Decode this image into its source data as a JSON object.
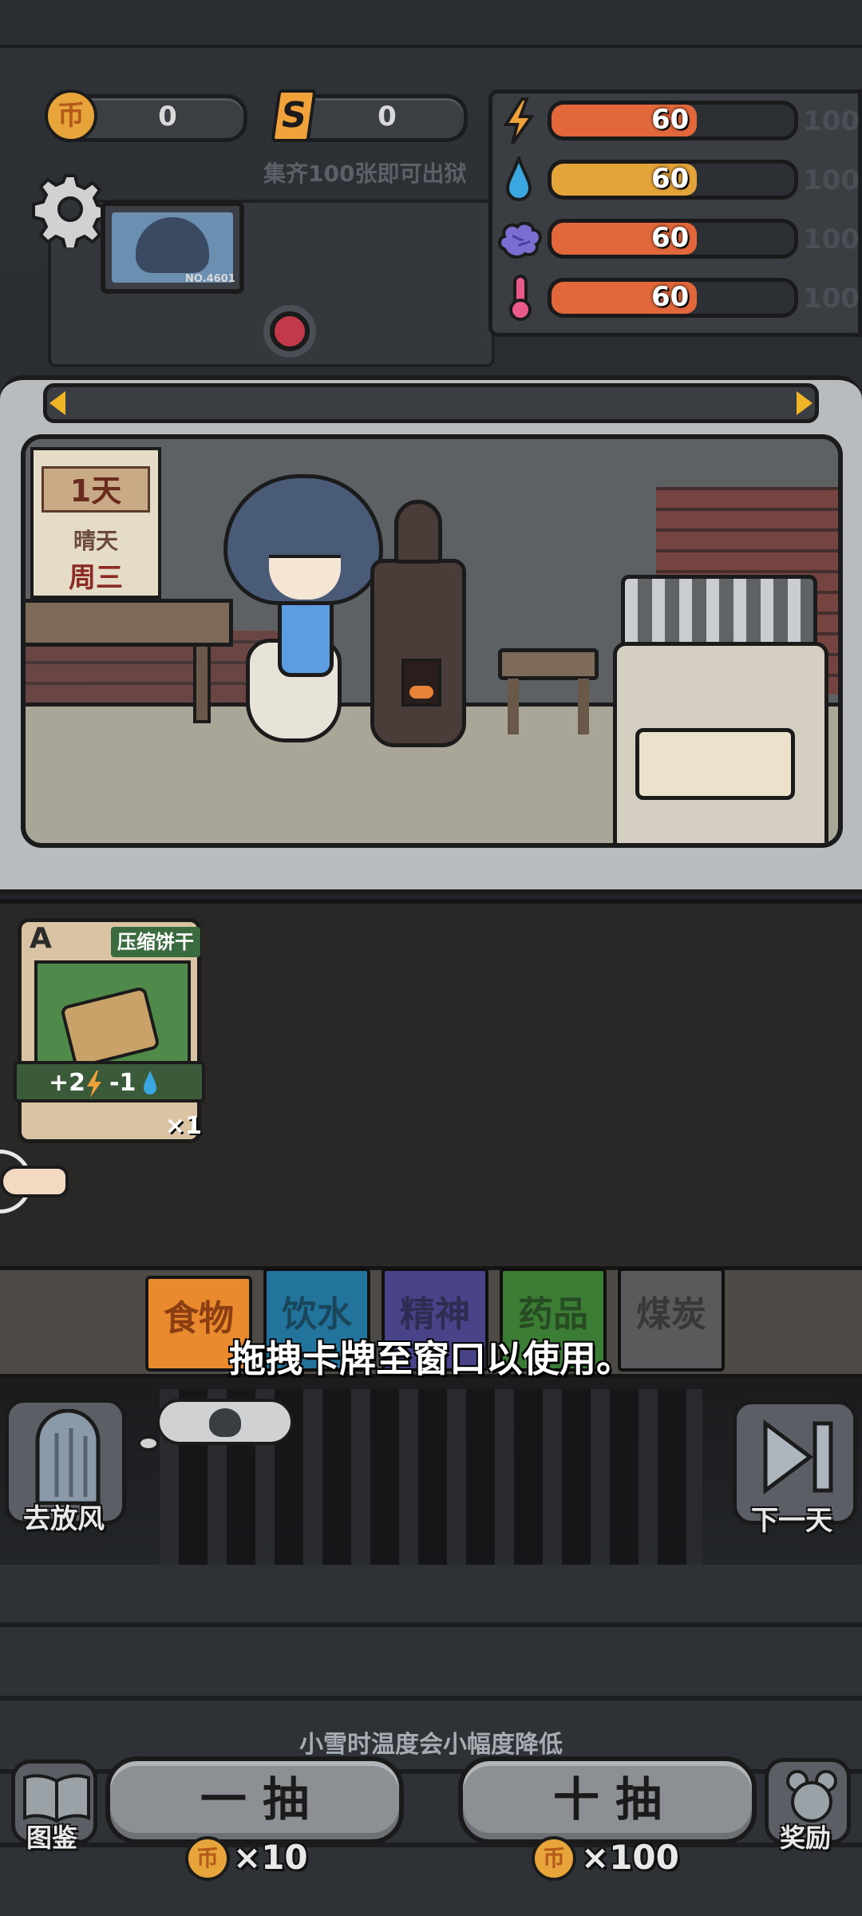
{
  "currency": {
    "coins": "0",
    "tickets": "0",
    "coin_glyph": "币",
    "ticket_glyph": "S"
  },
  "collect_hint": "集齐100张即可出狱",
  "portrait_id": "NO.4601",
  "stats": [
    {
      "name": "energy",
      "icon": "lightning-icon",
      "value": "60",
      "max": "100",
      "fill_fraction": 0.6,
      "color": "#e2683b"
    },
    {
      "name": "water",
      "icon": "water-drop-icon",
      "value": "60",
      "max": "100",
      "fill_fraction": 0.6,
      "color": "#e5a43a"
    },
    {
      "name": "mind",
      "icon": "brain-icon",
      "value": "60",
      "max": "100",
      "fill_fraction": 0.6,
      "color": "#e2683b"
    },
    {
      "name": "temperature",
      "icon": "thermometer-icon",
      "value": "60",
      "max": "100",
      "fill_fraction": 0.6,
      "color": "#e2683b"
    }
  ],
  "calendar": {
    "day": "1天",
    "weather": "晴天",
    "weekday": "周三"
  },
  "card": {
    "grade": "A",
    "name": "压缩饼干",
    "effect_plus": "+2",
    "effect_minus": "-1",
    "count": "×1"
  },
  "tabs": [
    {
      "label": "食物",
      "color": "#e98a2e",
      "active": true
    },
    {
      "label": "饮水",
      "color": "#2e9bd0",
      "active": false
    },
    {
      "label": "精神",
      "color": "#6159b8",
      "active": false
    },
    {
      "label": "药品",
      "color": "#4fa746",
      "active": false
    },
    {
      "label": "煤炭",
      "color": "#77787a",
      "active": false
    }
  ],
  "tutorial_text": "拖拽卡牌至窗口以使用。",
  "buttons": {
    "outing": "去放风",
    "next_day": "下一天",
    "codex": "图鉴",
    "rewards": "奖励"
  },
  "weather_tip": "小雪时温度会小幅度降低",
  "draw": {
    "single_label": "一 抽",
    "single_cost": "×10",
    "ten_label": "十 抽",
    "ten_cost": "×100"
  }
}
